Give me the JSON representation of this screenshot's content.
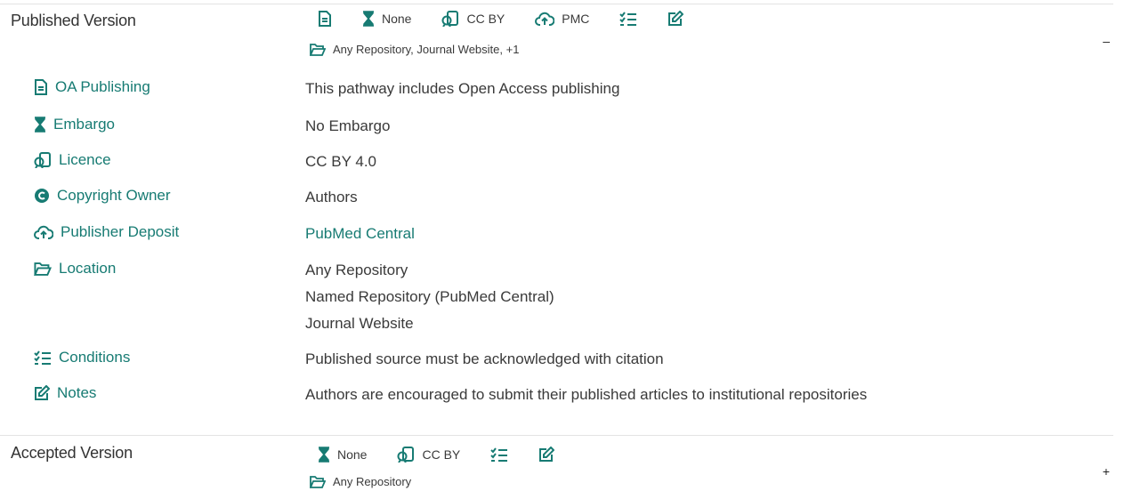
{
  "published": {
    "title": "Published Version",
    "toggle": "–",
    "summary": {
      "embargo": "None",
      "licence": "CC BY",
      "deposit": "PMC",
      "location": "Any Repository, Journal Website, +1"
    },
    "details": {
      "oa_label": "OA Publishing",
      "oa_value": "This pathway includes Open Access publishing",
      "embargo_label": "Embargo",
      "embargo_value": "No Embargo",
      "licence_label": "Licence",
      "licence_value": "CC BY 4.0",
      "copyright_label": "Copyright Owner",
      "copyright_value": "Authors",
      "deposit_label": "Publisher Deposit",
      "deposit_value": "PubMed Central",
      "location_label": "Location",
      "locations": [
        "Any Repository",
        "Named Repository (PubMed Central)",
        "Journal Website"
      ],
      "conditions_label": "Conditions",
      "conditions_value": "Published source must be acknowledged with citation",
      "notes_label": "Notes",
      "notes_value": "Authors are encouraged to submit their published articles to institutional repositories"
    }
  },
  "accepted": {
    "title": "Accepted Version",
    "toggle": "+",
    "summary": {
      "embargo": "None",
      "licence": "CC BY",
      "location": "Any Repository"
    }
  },
  "colors": {
    "accent": "#177b73",
    "text": "#3a3a3a",
    "divider": "#e3e3e3"
  }
}
